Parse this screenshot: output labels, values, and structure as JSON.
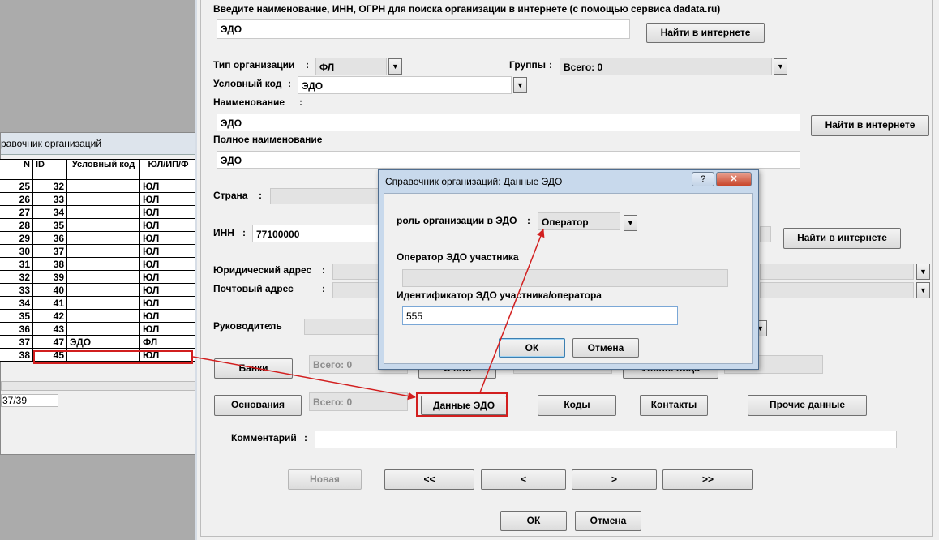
{
  "bg_window": {
    "title": "равочник организаций",
    "columns": [
      "N",
      "ID",
      "Условный код",
      "ЮЛ/ИП/Ф"
    ],
    "rows": [
      {
        "n": "25",
        "id": "32",
        "code": "",
        "type": "ЮЛ"
      },
      {
        "n": "26",
        "id": "33",
        "code": "",
        "type": "ЮЛ"
      },
      {
        "n": "27",
        "id": "34",
        "code": "",
        "type": "ЮЛ"
      },
      {
        "n": "28",
        "id": "35",
        "code": "",
        "type": "ЮЛ"
      },
      {
        "n": "29",
        "id": "36",
        "code": "",
        "type": "ЮЛ"
      },
      {
        "n": "30",
        "id": "37",
        "code": "",
        "type": "ЮЛ"
      },
      {
        "n": "31",
        "id": "38",
        "code": "",
        "type": "ЮЛ"
      },
      {
        "n": "32",
        "id": "39",
        "code": "",
        "type": "ЮЛ"
      },
      {
        "n": "33",
        "id": "40",
        "code": "",
        "type": "ЮЛ"
      },
      {
        "n": "34",
        "id": "41",
        "code": "",
        "type": "ЮЛ"
      },
      {
        "n": "35",
        "id": "42",
        "code": "",
        "type": "ЮЛ"
      },
      {
        "n": "36",
        "id": "43",
        "code": "",
        "type": "ЮЛ"
      },
      {
        "n": "37",
        "id": "47",
        "code": "ЭДО",
        "type": "ФЛ"
      },
      {
        "n": "38",
        "id": "45",
        "code": "",
        "type": "ЮЛ"
      }
    ],
    "record_status": "37/39"
  },
  "form": {
    "search_prompt": "Введите наименование, ИНН, ОГРН для поиска организации в интернете (с помощью сервиса dadata.ru)",
    "search_value": "ЭДО",
    "find_online": "Найти в интернете",
    "org_type_label": "Тип организации",
    "org_type_value": "ФЛ",
    "groups_label": "Группы",
    "groups_value": "Всего: 0",
    "code_label": "Условный код",
    "code_value": "ЭДО",
    "name_label": "Наименование",
    "name_value": "ЭДО",
    "full_name_label": "Полное наименование",
    "full_name_value": "ЭДО",
    "country_label": "Страна",
    "inn_label": "ИНН",
    "inn_value": "77100000",
    "legal_address_label": "Юридический адрес",
    "postal_address_label": "Почтовый адрес",
    "head_label": "Руководитель",
    "colon": ":",
    "banks_button": "Банки",
    "total_zero": "Всего: 0",
    "accounts_button": "Счета",
    "authorized_button": "Уполн. лица",
    "partial_zero": "0",
    "grounds_button": "Основания",
    "edo_button": "Данные ЭДО",
    "codes_button": "Коды",
    "contacts_button": "Контакты",
    "other_button": "Прочие данные",
    "comment_label": "Комментарий",
    "new_button": "Новая",
    "first_button": "<<",
    "prev_button": "<",
    "next_button": ">",
    "last_button": ">>",
    "ok_button": "ОК",
    "cancel_button": "Отмена"
  },
  "dialog": {
    "title": "Справочник организаций: Данные ЭДО",
    "help_glyph": "?",
    "close_glyph": "✕",
    "role_label": "роль организации в ЭДО",
    "colon": ":",
    "role_value": "Оператор",
    "operator_label": "Оператор ЭДО участника",
    "operator_value": "",
    "identifier_label": "Идентификатор ЭДО участника/оператора",
    "identifier_value": "555",
    "ok_button": "ОК",
    "cancel_button": "Отмена"
  },
  "icons": {
    "dropdown": "chevron-down-icon",
    "help": "help-icon",
    "close": "close-icon"
  },
  "colors": {
    "annotation_red": "#d21f1f",
    "dialog_frame": "#c8d9ec"
  }
}
